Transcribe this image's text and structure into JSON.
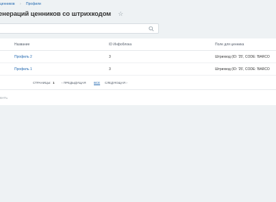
{
  "breadcrumb": {
    "parent": "ценников",
    "current": "Профили"
  },
  "header": {
    "title": "енераций ценников со штрихкодом"
  },
  "search": {
    "placeholder": ""
  },
  "table": {
    "columns": [
      "Название",
      "ID Инфоблока",
      "Поле для ценника"
    ],
    "rows": [
      {
        "name": "Профиль 2",
        "iblock_id": "3",
        "field": "Штрихкод (ID: '25', CODE: 'BARCO"
      },
      {
        "name": "Профиль 1",
        "iblock_id": "3",
        "field": "Штрихкод (ID: '25', CODE: 'BARCO"
      }
    ]
  },
  "pager": {
    "pages_label": "СТРАНИЦЫ:",
    "page_number": "1",
    "prev_label": "ПРЕДЫДУЩАЯ",
    "all_label": "ВСЕ",
    "next_label": "СЛЕДУЮЩАЯ"
  },
  "footer": {
    "action_label": "ВАТЬ"
  }
}
